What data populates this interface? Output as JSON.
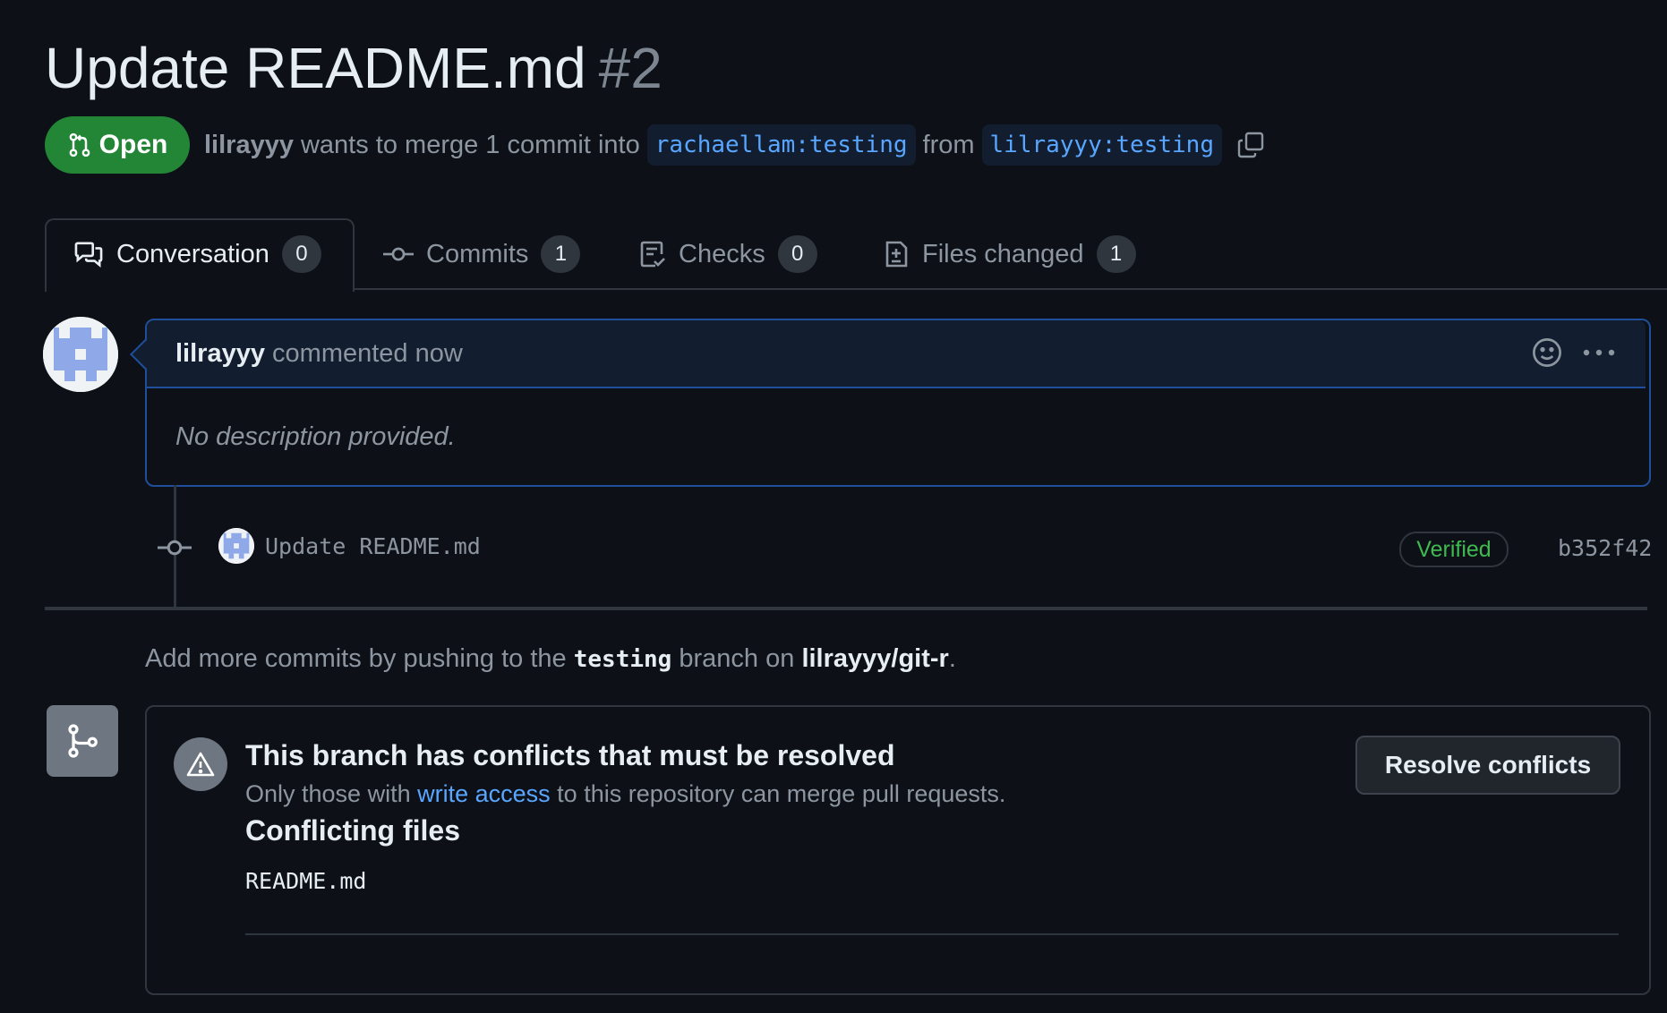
{
  "pr": {
    "title": "Update README.md",
    "number": "#2",
    "state": "Open",
    "author": "lilrayyy",
    "merge_text": "wants to merge 1 commit into",
    "base_branch": "rachaellam:testing",
    "from_text": "from",
    "head_branch": "lilrayyy:testing"
  },
  "tabs": [
    {
      "label": "Conversation",
      "count": "0",
      "icon": "comment-discussion-icon"
    },
    {
      "label": "Commits",
      "count": "1",
      "icon": "git-commit-icon"
    },
    {
      "label": "Checks",
      "count": "0",
      "icon": "checklist-icon"
    },
    {
      "label": "Files changed",
      "count": "1",
      "icon": "file-diff-icon"
    }
  ],
  "comment": {
    "author": "lilrayyy",
    "action": "commented now",
    "body": "No description provided."
  },
  "commit": {
    "message": "Update README.md",
    "badge": "Verified",
    "sha": "b352f42"
  },
  "push_note": {
    "prefix": "Add more commits by pushing to the",
    "branch": "testing",
    "middle": "branch on",
    "repo": "lilrayyy/git-r",
    "suffix": "."
  },
  "merge": {
    "title": "This branch has conflicts that must be resolved",
    "sub_prefix": "Only those with",
    "sub_link": "write access",
    "sub_suffix": "to this repository can merge pull requests.",
    "files_title": "Conflicting files",
    "files": [
      "README.md"
    ],
    "resolve_label": "Resolve conflicts"
  },
  "colors": {
    "background": "#0d1117",
    "open_green": "#238636",
    "link_blue": "#58a6ff",
    "verified_green": "#3fb950",
    "comment_border": "#1f4e9a"
  }
}
